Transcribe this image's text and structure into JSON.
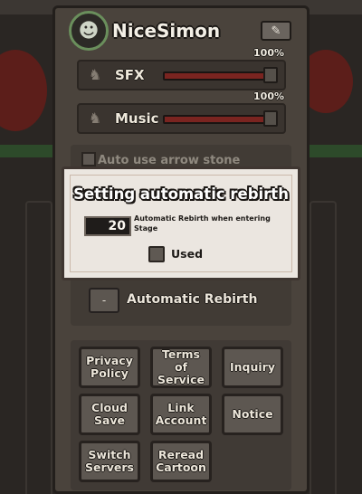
{
  "header": {
    "username": "NiceSimon",
    "avatar_icon": "helmet-character-icon",
    "edit_icon": "pencil-icon"
  },
  "audio": {
    "sfx": {
      "label": "SFX",
      "percent_label": "100%",
      "level": 1.0
    },
    "music": {
      "label": "Music",
      "percent_label": "100%",
      "level": 1.0
    }
  },
  "options": {
    "auto_arrow_label": "Auto use arrow stone",
    "rebirth_button_label": "-",
    "rebirth_label": "Automatic Rebirth"
  },
  "buttons": [
    {
      "label": "Privacy\nPolicy"
    },
    {
      "label": "Terms\nof\nService"
    },
    {
      "label": "Inquiry"
    },
    {
      "label": "Cloud\nSave"
    },
    {
      "label": "Link\nAccount"
    },
    {
      "label": "Notice"
    },
    {
      "label": "Switch\nServers"
    },
    {
      "label": "Reread\nCartoon"
    }
  ],
  "modal": {
    "title": "Setting automatic rebirth",
    "stage_value": "20",
    "stage_caption": "Automatic Rebirth when entering Stage",
    "used_label": "Used"
  },
  "colors": {
    "panel": "#4a433c",
    "modal_bg": "#ebe6e0",
    "slider_fill": "#7a2420"
  }
}
